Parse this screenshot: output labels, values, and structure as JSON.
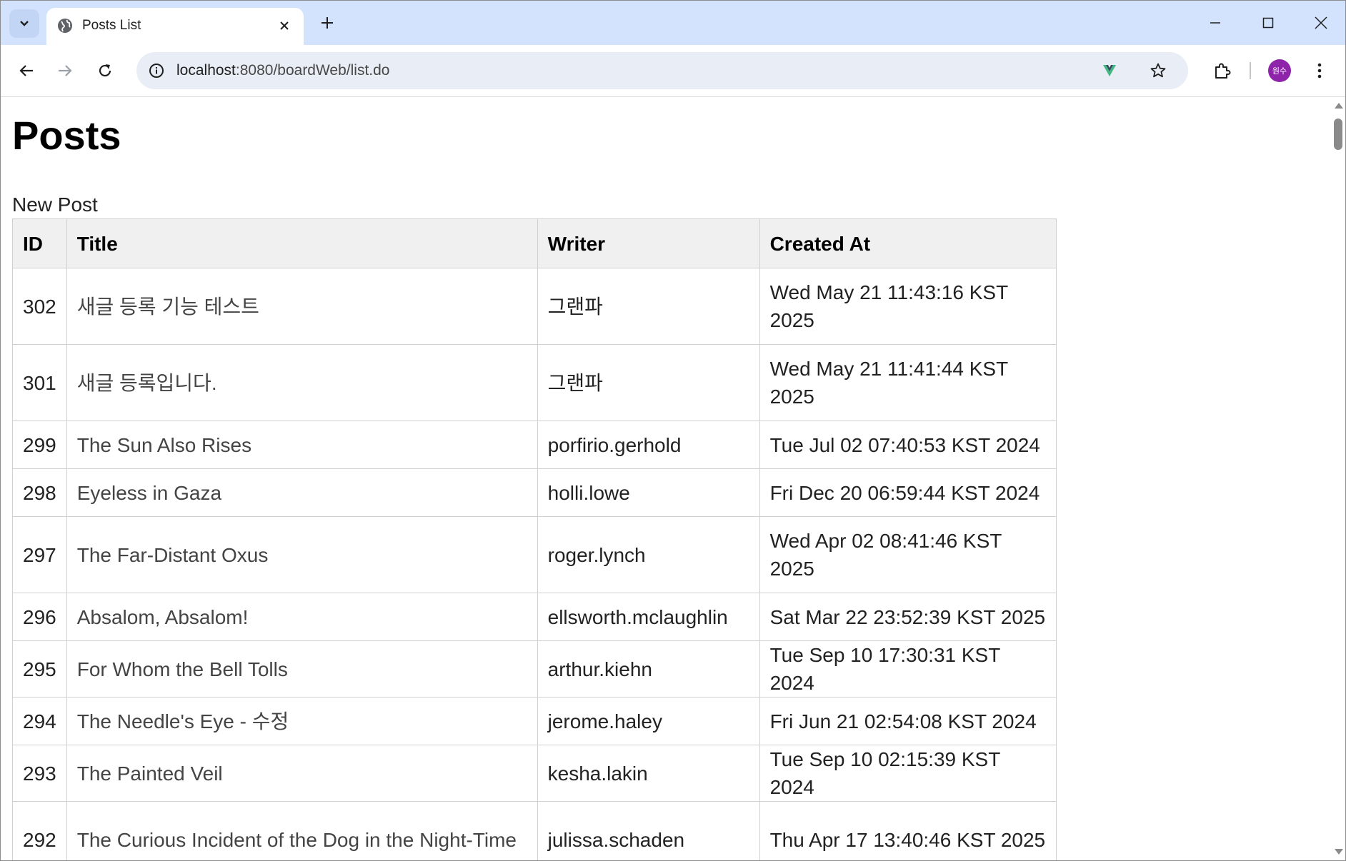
{
  "browser": {
    "tab_title": "Posts List",
    "url_host": "localhost",
    "url_path": ":8080/boardWeb/list.do",
    "profile_initials": "원수"
  },
  "page": {
    "title": "Posts",
    "new_post_link": "New Post"
  },
  "table": {
    "headers": [
      "ID",
      "Title",
      "Writer",
      "Created At"
    ],
    "rows": [
      {
        "id": "302",
        "title": "새글 등록 기능 테스트",
        "writer": "그랜파",
        "created_at": "Wed May 21 11:43:16 KST 2025"
      },
      {
        "id": "301",
        "title": "새글 등록입니다.",
        "writer": "그랜파",
        "created_at": "Wed May 21 11:41:44 KST 2025"
      },
      {
        "id": "299",
        "title": "The Sun Also Rises",
        "writer": "porfirio.gerhold",
        "created_at": "Tue Jul 02 07:40:53 KST 2024"
      },
      {
        "id": "298",
        "title": "Eyeless in Gaza",
        "writer": "holli.lowe",
        "created_at": "Fri Dec 20 06:59:44 KST 2024"
      },
      {
        "id": "297",
        "title": "The Far-Distant Oxus",
        "writer": "roger.lynch",
        "created_at": "Wed Apr 02 08:41:46 KST 2025"
      },
      {
        "id": "296",
        "title": "Absalom, Absalom!",
        "writer": "ellsworth.mclaughlin",
        "created_at": "Sat Mar 22 23:52:39 KST 2025"
      },
      {
        "id": "295",
        "title": "For Whom the Bell Tolls",
        "writer": "arthur.kiehn",
        "created_at": "Tue Sep 10 17:30:31 KST 2024"
      },
      {
        "id": "294",
        "title": "The Needle's Eye - 수정",
        "writer": "jerome.haley",
        "created_at": "Fri Jun 21 02:54:08 KST 2024"
      },
      {
        "id": "293",
        "title": "The Painted Veil",
        "writer": "kesha.lakin",
        "created_at": "Tue Sep 10 02:15:39 KST 2024"
      },
      {
        "id": "292",
        "title": "The Curious Incident of the Dog in the Night-Time",
        "writer": "julissa.schaden",
        "created_at": "Thu Apr 17 13:40:46 KST 2025"
      }
    ]
  }
}
